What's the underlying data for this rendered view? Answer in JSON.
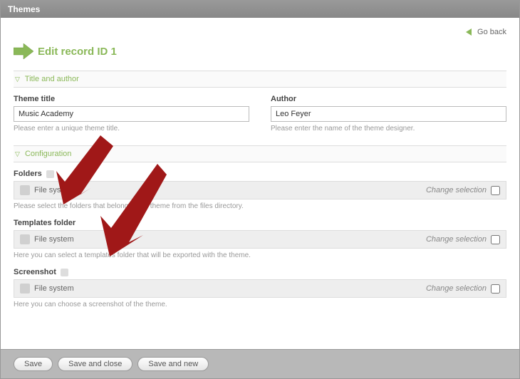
{
  "header": {
    "title": "Themes"
  },
  "goback": {
    "label": "Go back"
  },
  "page_heading": "Edit record ID 1",
  "sections": {
    "title_author": {
      "legend": "Title and author",
      "theme_title": {
        "label": "Theme title",
        "value": "Music Academy",
        "help": "Please enter a unique theme title."
      },
      "author": {
        "label": "Author",
        "value": "Leo Feyer",
        "help": "Please enter the name of the theme designer."
      }
    },
    "configuration": {
      "legend": "Configuration",
      "folders": {
        "label": "Folders",
        "selected": "File system",
        "change": "Change selection",
        "help": "Please select the folders that belong to the theme from the files directory."
      },
      "templates": {
        "label": "Templates folder",
        "selected": "File system",
        "change": "Change selection",
        "help": "Here you can select a templates folder that will be exported with the theme."
      },
      "screenshot": {
        "label": "Screenshot",
        "selected": "File system",
        "change": "Change selection",
        "help": "Here you can choose a screenshot of the theme."
      }
    }
  },
  "buttons": {
    "save": "Save",
    "save_close": "Save and close",
    "save_new": "Save and new"
  }
}
